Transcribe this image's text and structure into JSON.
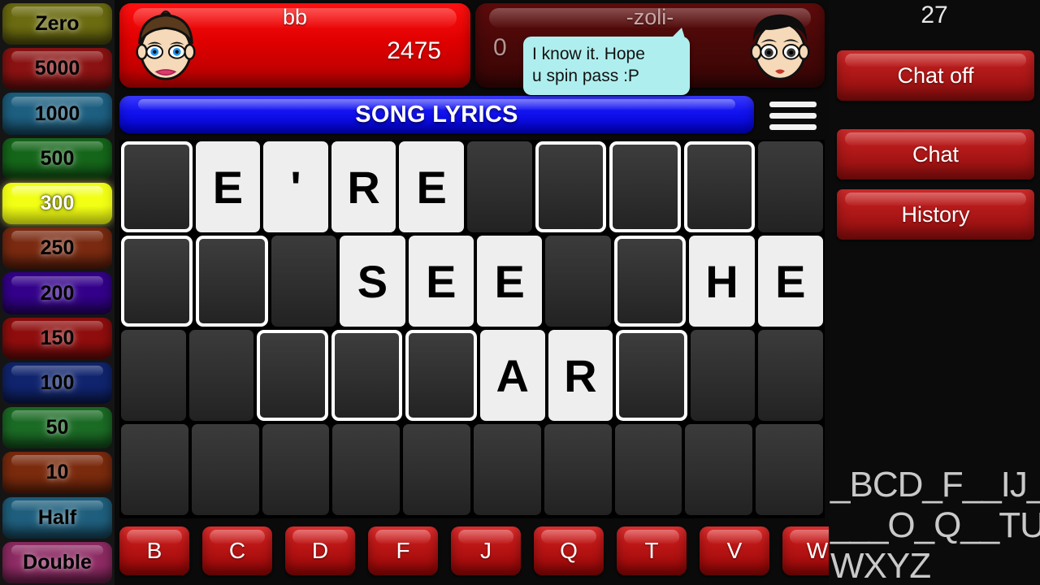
{
  "wheel": {
    "slots": [
      {
        "label": "Zero",
        "color": "#6b6b11",
        "active": false
      },
      {
        "label": "5000",
        "color": "#8b1212",
        "active": false
      },
      {
        "label": "1000",
        "color": "#1d5f80",
        "active": false
      },
      {
        "label": "500",
        "color": "#15661a",
        "active": false
      },
      {
        "label": "300",
        "color": "#f2ff14",
        "active": true
      },
      {
        "label": "250",
        "color": "#7a2a10",
        "active": false
      },
      {
        "label": "200",
        "color": "#33008a",
        "active": false
      },
      {
        "label": "150",
        "color": "#8f0d0d",
        "active": false
      },
      {
        "label": "100",
        "color": "#10246e",
        "active": false
      },
      {
        "label": "50",
        "color": "#1b6b25",
        "active": false
      },
      {
        "label": "10",
        "color": "#7a2a0d",
        "active": false
      },
      {
        "label": "Half",
        "color": "#1f5f7d",
        "active": false
      },
      {
        "label": "Double",
        "color": "#8d2a63",
        "active": false
      }
    ]
  },
  "players": [
    {
      "name": "bb",
      "score": "2475",
      "avatar": "female-avatar",
      "active": true,
      "panel_color": "#e00000"
    },
    {
      "name": "-zoli-",
      "score": "0",
      "avatar": "male-avatar",
      "active": false,
      "panel_color": "#4a0808"
    }
  ],
  "speech_bubble": {
    "line1": "I know it. Hope",
    "line2": "u spin pass :P",
    "color": "#AFEEEE"
  },
  "category": {
    "label": "SONG LYRICS",
    "color": "#0000d8"
  },
  "menu": {
    "icon": "hamburger-menu-icon"
  },
  "board": {
    "rows": [
      [
        {
          "state": "slot",
          "letter": ""
        },
        {
          "state": "letter",
          "letter": "E"
        },
        {
          "state": "letter",
          "letter": "'"
        },
        {
          "state": "letter",
          "letter": "R"
        },
        {
          "state": "letter",
          "letter": "E"
        },
        {
          "state": "blank",
          "letter": ""
        },
        {
          "state": "slot",
          "letter": ""
        },
        {
          "state": "slot",
          "letter": ""
        },
        {
          "state": "slot",
          "letter": ""
        },
        {
          "state": "blank",
          "letter": ""
        }
      ],
      [
        {
          "state": "slot",
          "letter": ""
        },
        {
          "state": "slot",
          "letter": ""
        },
        {
          "state": "blank",
          "letter": ""
        },
        {
          "state": "letter",
          "letter": "S"
        },
        {
          "state": "letter",
          "letter": "E"
        },
        {
          "state": "letter",
          "letter": "E"
        },
        {
          "state": "blank",
          "letter": ""
        },
        {
          "state": "slot",
          "letter": ""
        },
        {
          "state": "letter",
          "letter": "H"
        },
        {
          "state": "letter",
          "letter": "E"
        }
      ],
      [
        {
          "state": "blank",
          "letter": ""
        },
        {
          "state": "blank",
          "letter": ""
        },
        {
          "state": "slot",
          "letter": ""
        },
        {
          "state": "slot",
          "letter": ""
        },
        {
          "state": "slot",
          "letter": ""
        },
        {
          "state": "letter",
          "letter": "A"
        },
        {
          "state": "letter",
          "letter": "R"
        },
        {
          "state": "slot",
          "letter": ""
        },
        {
          "state": "blank",
          "letter": ""
        },
        {
          "state": "blank",
          "letter": ""
        }
      ],
      [
        {
          "state": "blank",
          "letter": ""
        },
        {
          "state": "blank",
          "letter": ""
        },
        {
          "state": "blank",
          "letter": ""
        },
        {
          "state": "blank",
          "letter": ""
        },
        {
          "state": "blank",
          "letter": ""
        },
        {
          "state": "blank",
          "letter": ""
        },
        {
          "state": "blank",
          "letter": ""
        },
        {
          "state": "blank",
          "letter": ""
        },
        {
          "state": "blank",
          "letter": ""
        },
        {
          "state": "blank",
          "letter": ""
        }
      ]
    ]
  },
  "letter_buttons": [
    "B",
    "C",
    "D",
    "F",
    "J",
    "Q",
    "T",
    "V",
    "W"
  ],
  "right_panel": {
    "timer": "27",
    "buttons": [
      {
        "label": "Chat off"
      },
      {
        "label": "Chat"
      },
      {
        "label": "History"
      }
    ],
    "used_letters": "_BCD_F__IJ_\n___O_Q__TUV\nWXYZ"
  }
}
